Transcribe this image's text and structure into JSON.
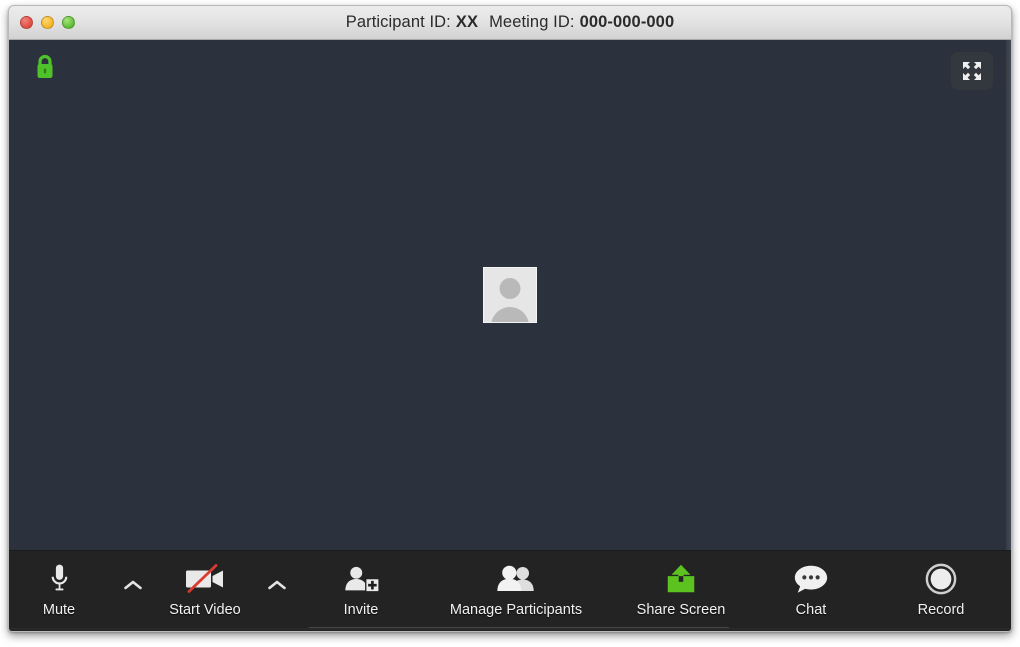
{
  "window": {
    "titlebar": {
      "participant_label": "Participant ID:",
      "participant_id": "XX",
      "meeting_label": "Meeting ID:",
      "meeting_id": "000-000-000",
      "close_button": "close",
      "minimize_button": "minimize",
      "maximize_button": "maximize"
    }
  },
  "stage": {
    "lock_icon": "lock-icon",
    "lock_color": "#4fc22a",
    "fullscreen_icon": "fullscreen-expand-icon",
    "avatar_icon": "default-user-avatar",
    "background_color": "#2b323d"
  },
  "toolbar": {
    "background_color": "#232323",
    "items": [
      {
        "id": "mute",
        "label": "Mute",
        "icon": "microphone-icon",
        "has_chevron": true,
        "label_color": "#f2f2f2"
      },
      {
        "id": "start-video",
        "label": "Start Video",
        "icon": "video-camera-off-icon",
        "has_chevron": true,
        "label_color": "#f2f2f2",
        "slash_color": "#d93b30"
      },
      {
        "id": "invite",
        "label": "Invite",
        "icon": "person-add-icon",
        "has_chevron": false,
        "label_color": "#f2f2f2"
      },
      {
        "id": "manage-participants",
        "label": "Manage Participants",
        "icon": "two-people-icon",
        "has_chevron": false,
        "label_color": "#f2f2f2"
      },
      {
        "id": "share-screen",
        "label": "Share Screen",
        "icon": "share-screen-icon",
        "has_chevron": false,
        "label_color": "#f2f2f2",
        "icon_color": "#5cc220"
      },
      {
        "id": "chat",
        "label": "Chat",
        "icon": "chat-bubble-icon",
        "has_chevron": false,
        "label_color": "#f2f2f2"
      },
      {
        "id": "record",
        "label": "Record",
        "icon": "record-circle-icon",
        "has_chevron": false,
        "label_color": "#f2f2f2"
      }
    ]
  }
}
